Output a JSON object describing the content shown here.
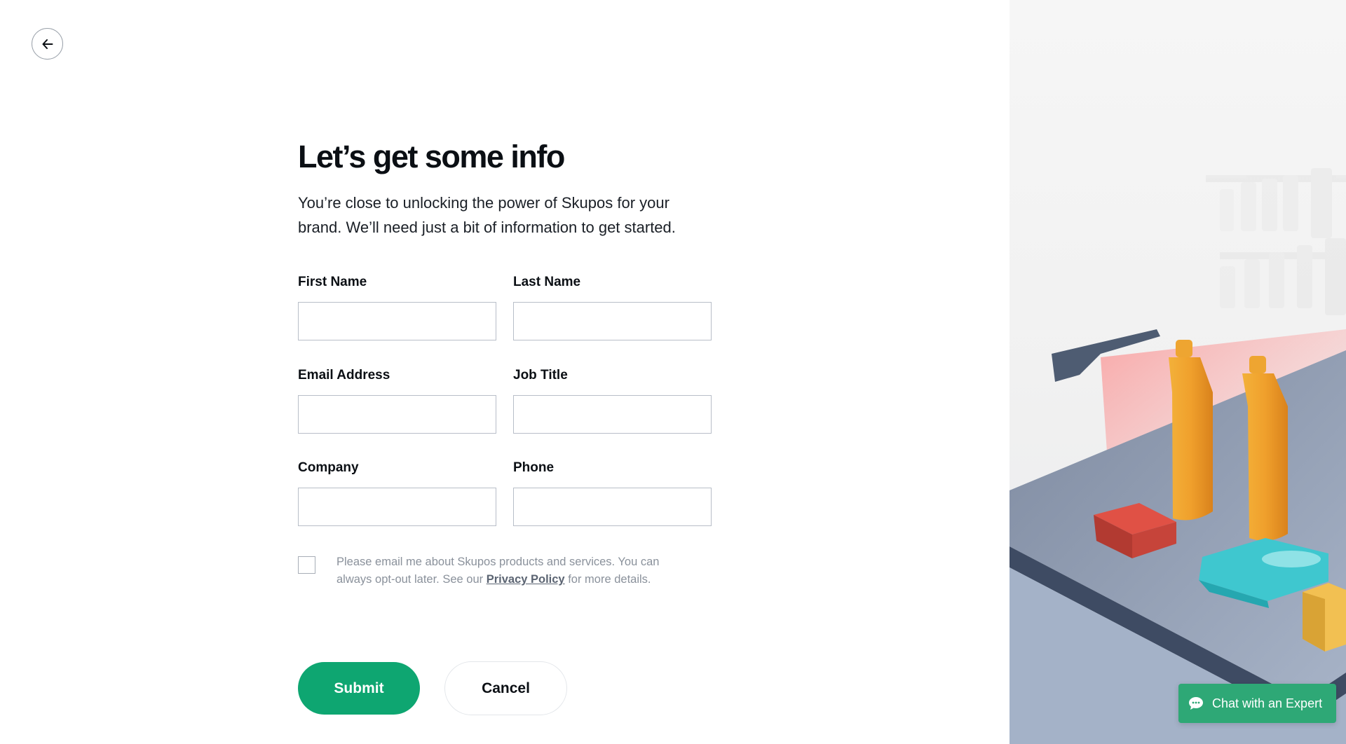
{
  "back_button": {
    "icon": "arrow-left-icon"
  },
  "form": {
    "title": "Let’s get some info",
    "subtitle": "You’re close to unlocking the power of Skupos for your brand. We’ll need just a bit of information to get started.",
    "fields": {
      "first_name": {
        "label": "First Name",
        "value": "",
        "placeholder": ""
      },
      "last_name": {
        "label": "Last Name",
        "value": "",
        "placeholder": ""
      },
      "email": {
        "label": "Email Address",
        "value": "",
        "placeholder": ""
      },
      "job_title": {
        "label": "Job Title",
        "value": "",
        "placeholder": ""
      },
      "company": {
        "label": "Company",
        "value": "",
        "placeholder": ""
      },
      "phone": {
        "label": "Phone",
        "value": "",
        "placeholder": ""
      }
    },
    "consent": {
      "checked": false,
      "text_before": "Please email me about Skupos products and services. You can always opt-out later. See our ",
      "link_text": "Privacy Policy",
      "text_after": " for more details."
    },
    "submit_label": "Submit",
    "cancel_label": "Cancel"
  },
  "chat": {
    "label": "Chat with an Expert",
    "icon": "chat-bubble-icon"
  },
  "colors": {
    "accent": "#0ea671",
    "chat": "#2ea876",
    "text": "#0b0f14",
    "muted": "#8a919b"
  }
}
